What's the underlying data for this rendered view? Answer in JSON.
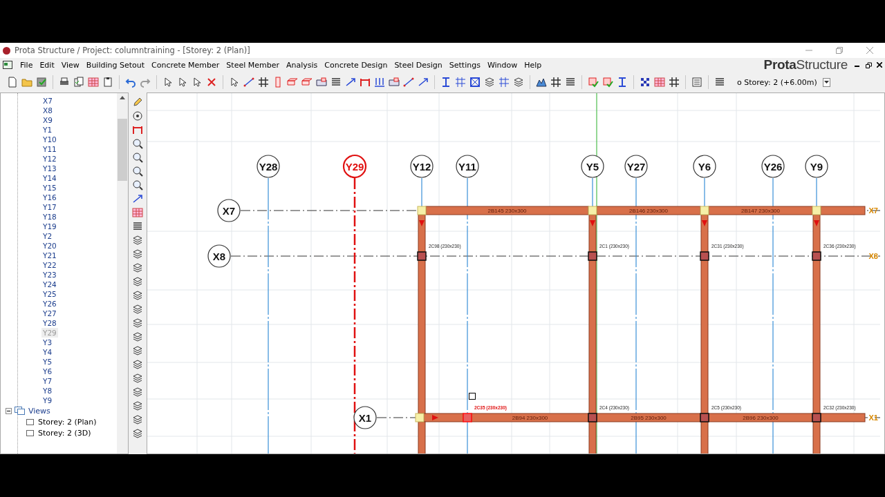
{
  "window": {
    "title": "Prota Structure / Project: columntraining - [Storey: 2 (Plan)]"
  },
  "menu": [
    "File",
    "Edit",
    "View",
    "Building Setout",
    "Concrete Member",
    "Steel Member",
    "Analysis",
    "Concrete Design",
    "Steel Design",
    "Settings",
    "Window",
    "Help"
  ],
  "logo": "**Prota**Structure",
  "storey_select": {
    "value": "o Storey: 2 (+6.00m)"
  },
  "tree": {
    "items": [
      {
        "label": "X7",
        "selected": false
      },
      {
        "label": "X8",
        "selected": false
      },
      {
        "label": "X9",
        "selected": false
      },
      {
        "label": "Y1",
        "selected": false
      },
      {
        "label": "Y10",
        "selected": false
      },
      {
        "label": "Y11",
        "selected": false
      },
      {
        "label": "Y12",
        "selected": false
      },
      {
        "label": "Y13",
        "selected": false
      },
      {
        "label": "Y14",
        "selected": false
      },
      {
        "label": "Y15",
        "selected": false
      },
      {
        "label": "Y16",
        "selected": false
      },
      {
        "label": "Y17",
        "selected": false
      },
      {
        "label": "Y18",
        "selected": false
      },
      {
        "label": "Y19",
        "selected": false
      },
      {
        "label": "Y2",
        "selected": false
      },
      {
        "label": "Y20",
        "selected": false
      },
      {
        "label": "Y21",
        "selected": false
      },
      {
        "label": "Y22",
        "selected": false
      },
      {
        "label": "Y23",
        "selected": false
      },
      {
        "label": "Y24",
        "selected": false
      },
      {
        "label": "Y25",
        "selected": false
      },
      {
        "label": "Y26",
        "selected": false
      },
      {
        "label": "Y27",
        "selected": false
      },
      {
        "label": "Y28",
        "selected": false
      },
      {
        "label": "Y29",
        "selected": true
      },
      {
        "label": "Y3",
        "selected": false
      },
      {
        "label": "Y4",
        "selected": false
      },
      {
        "label": "Y5",
        "selected": false
      },
      {
        "label": "Y6",
        "selected": false
      },
      {
        "label": "Y7",
        "selected": false
      },
      {
        "label": "Y8",
        "selected": false
      },
      {
        "label": "Y9",
        "selected": false
      }
    ],
    "views": {
      "label": "Views",
      "expanded": true,
      "children": [
        {
          "label": "Storey: 2 (Plan)"
        },
        {
          "label": "Storey: 2 (3D)"
        }
      ]
    }
  },
  "plan": {
    "axes_y": [
      {
        "label": "Y28",
        "selected": false
      },
      {
        "label": "Y29",
        "selected": true
      },
      {
        "label": "Y12",
        "selected": false
      },
      {
        "label": "Y11",
        "selected": false
      },
      {
        "label": "Y5",
        "selected": false
      },
      {
        "label": "Y27",
        "selected": false
      },
      {
        "label": "Y6",
        "selected": false
      },
      {
        "label": "Y26",
        "selected": false
      },
      {
        "label": "Y9",
        "selected": false
      }
    ],
    "axes_x": [
      {
        "label": "X7",
        "end_label": "X7"
      },
      {
        "label": "X8",
        "end_label": "X8"
      },
      {
        "label": "X1",
        "end_label": "X1"
      }
    ],
    "beams": [
      {
        "label": "2B145 230x300"
      },
      {
        "label": "2B146 230x300"
      },
      {
        "label": "2B147 230x300"
      },
      {
        "label": "2B94 230x300"
      },
      {
        "label": "2B95 230x300"
      },
      {
        "label": "2B96 230x300"
      }
    ],
    "columns": [
      {
        "label": "2C98 (230x230)",
        "selected": false
      },
      {
        "label": "2C1 (230x230)",
        "selected": false
      },
      {
        "label": "2C31 (230x230)",
        "selected": false
      },
      {
        "label": "2C36 (230x230)",
        "selected": false
      },
      {
        "label": "2C35 (230x230)",
        "selected": true
      },
      {
        "label": "2C4 (230x230)",
        "selected": false
      },
      {
        "label": "2C5 (230x230)",
        "selected": false
      },
      {
        "label": "2C32 (230x230)",
        "selected": false
      }
    ]
  }
}
